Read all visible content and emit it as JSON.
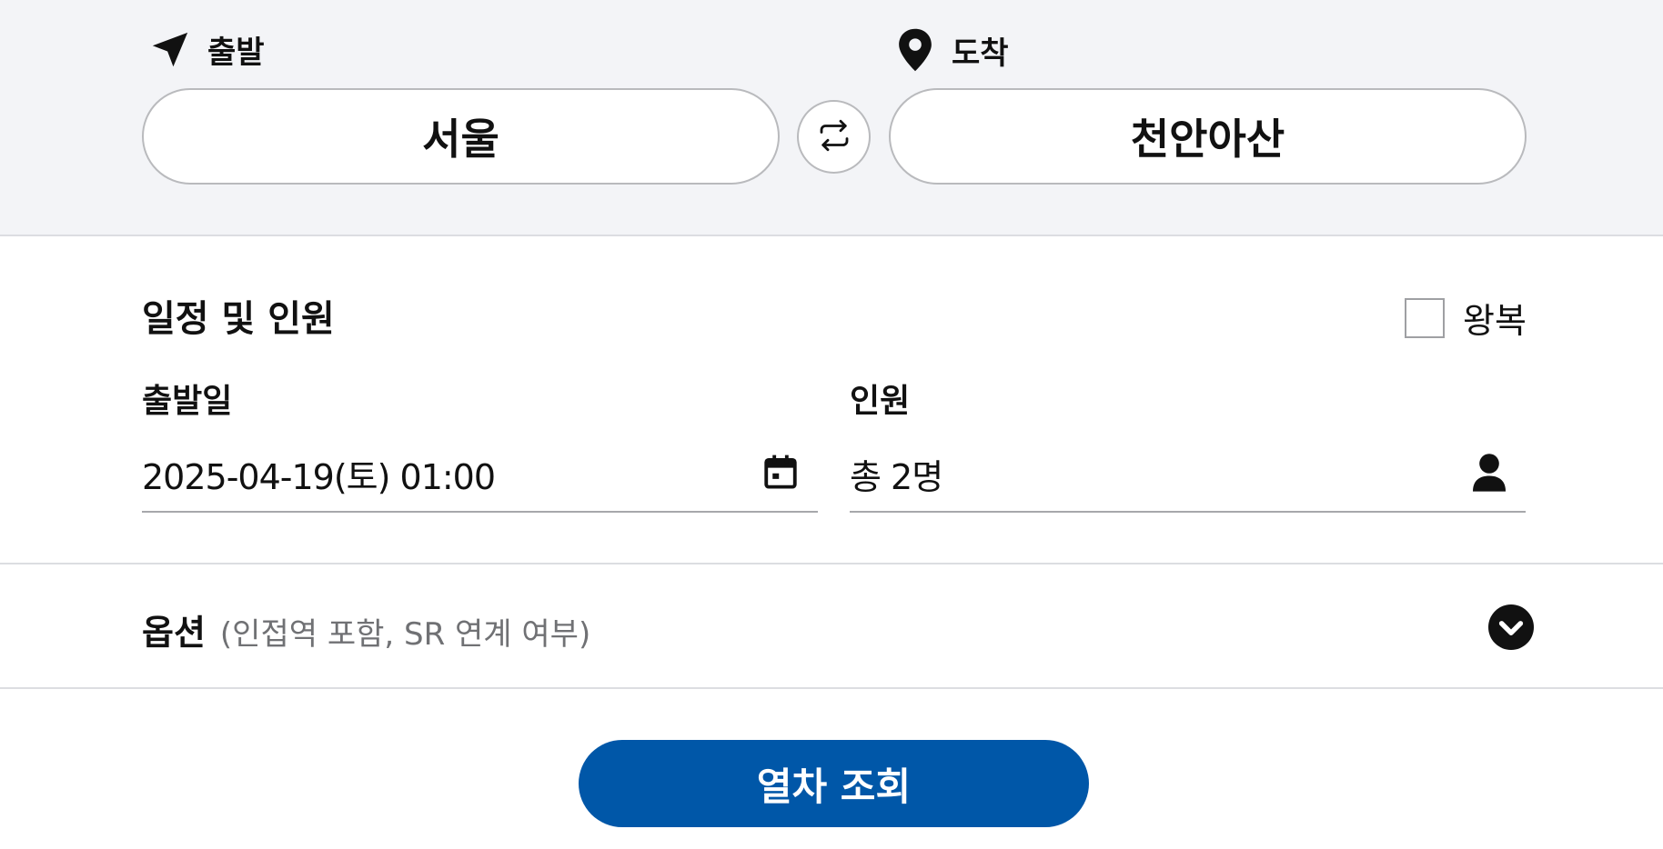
{
  "route": {
    "departure_label": "출발",
    "arrival_label": "도착",
    "departure_station": "서울",
    "arrival_station": "천안아산",
    "swap_icon": "swap-arrows-icon"
  },
  "schedule": {
    "title": "일정 및 인원",
    "roundtrip_label": "왕복",
    "roundtrip_checked": false,
    "date_label": "출발일",
    "date_value": "2025-04-19(토) 01:00",
    "passengers_label": "인원",
    "passengers_value": "총 2명"
  },
  "options": {
    "title": "옵션",
    "subtitle": "(인접역 포함, SR 연계 여부)",
    "expand_icon": "chevron-down-circle-icon"
  },
  "search_button": {
    "label": "열차 조회",
    "color": "#0057a8"
  }
}
